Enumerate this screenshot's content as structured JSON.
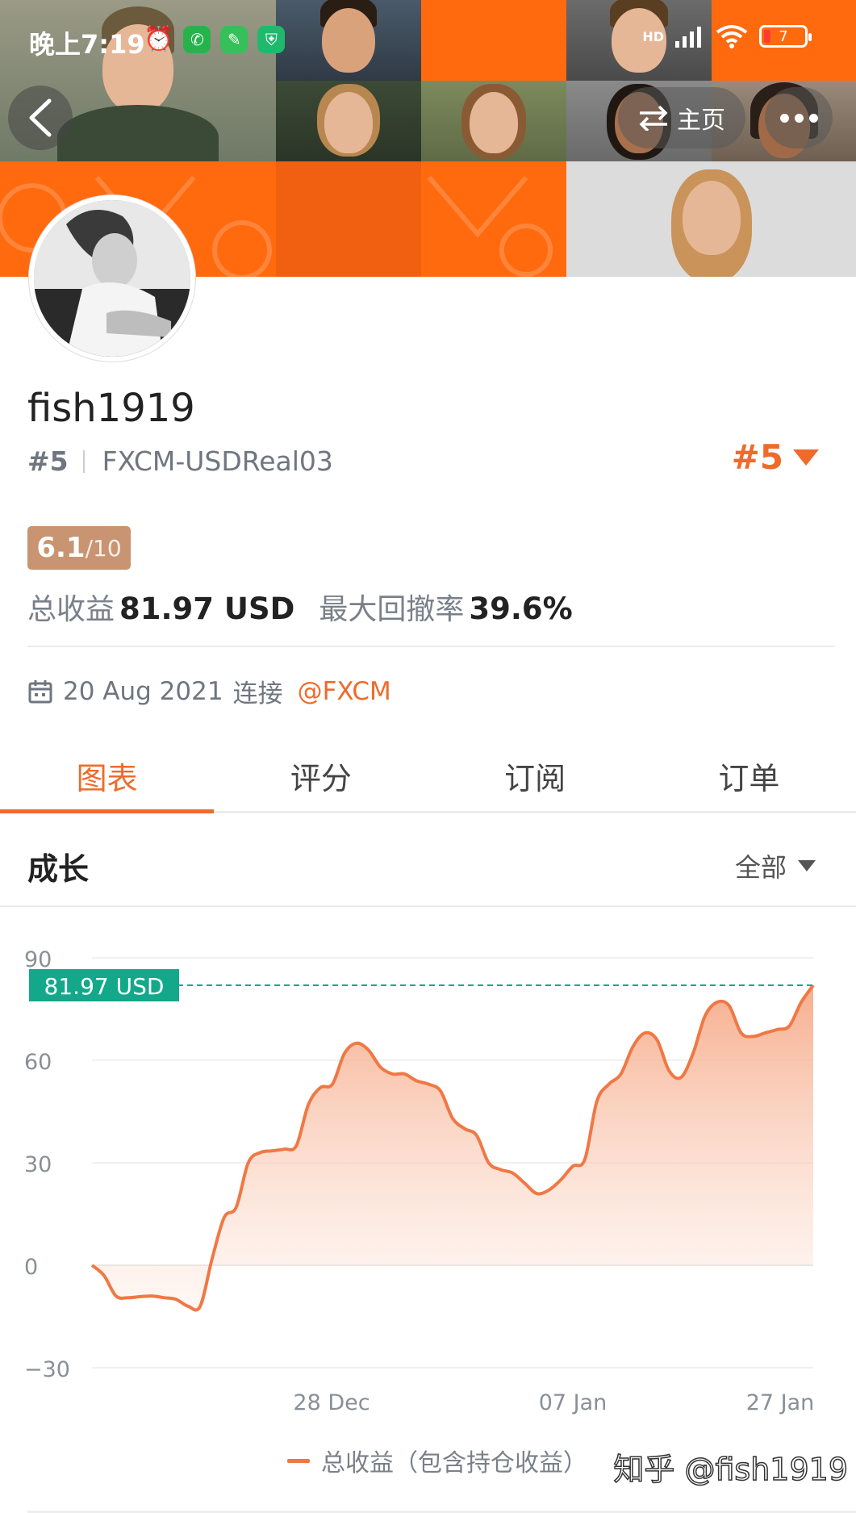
{
  "status_bar": {
    "time": "晚上7:19",
    "network": "HD",
    "battery": "7"
  },
  "header": {
    "home_label": "主页"
  },
  "profile": {
    "username": "fish1919",
    "rank": "#5",
    "server": "FXCM-USDReal03",
    "rank_right": "#5",
    "score": "6.1",
    "score_max": "/10",
    "total_profit_label": "总收益",
    "total_profit_value": "81.97 USD",
    "max_drawdown_label": "最大回撤率",
    "max_drawdown_value": "39.6%",
    "joined_date": "20 Aug 2021",
    "joined_label": "连接",
    "broker": "@FXCM"
  },
  "tabs": [
    {
      "label": "图表",
      "active": true
    },
    {
      "label": "评分",
      "active": false
    },
    {
      "label": "订阅",
      "active": false
    },
    {
      "label": "订单",
      "active": false
    }
  ],
  "chart_section": {
    "title": "成长",
    "filter": "全部"
  },
  "chart_data": {
    "type": "area",
    "title": "",
    "xlabel": "",
    "ylabel": "",
    "ylim": [
      -30,
      90
    ],
    "y_ticks": [
      90,
      60,
      30,
      0,
      -30
    ],
    "x_tick_labels": [
      "28 Dec",
      "07 Jan",
      "27 Jan"
    ],
    "current_value_label": "81.97 USD",
    "current_value": 81.97,
    "series": [
      {
        "name": "总收益（包含持仓收益）",
        "color": "#f07845",
        "values": [
          0,
          -3,
          -9,
          -9.5,
          -9.2,
          -9,
          -9.5,
          -10,
          -12,
          -12,
          2,
          14,
          17,
          30,
          33,
          33.5,
          34,
          35,
          47,
          52,
          53,
          62,
          65,
          63,
          58,
          56,
          56,
          54,
          53,
          51,
          43,
          40,
          38,
          30,
          28,
          27,
          24,
          21,
          22,
          25,
          29,
          31,
          48,
          53,
          56,
          64,
          68,
          66,
          57,
          55,
          62,
          73,
          77,
          76,
          68,
          67,
          68,
          69,
          70,
          77,
          81.97
        ]
      }
    ]
  },
  "watermark": "知乎 @fish1919",
  "colors": {
    "accent": "#f06a2a",
    "chart_line": "#f07845",
    "current_tag": "#14a88a",
    "banner_orange": "#ff6a0f"
  }
}
